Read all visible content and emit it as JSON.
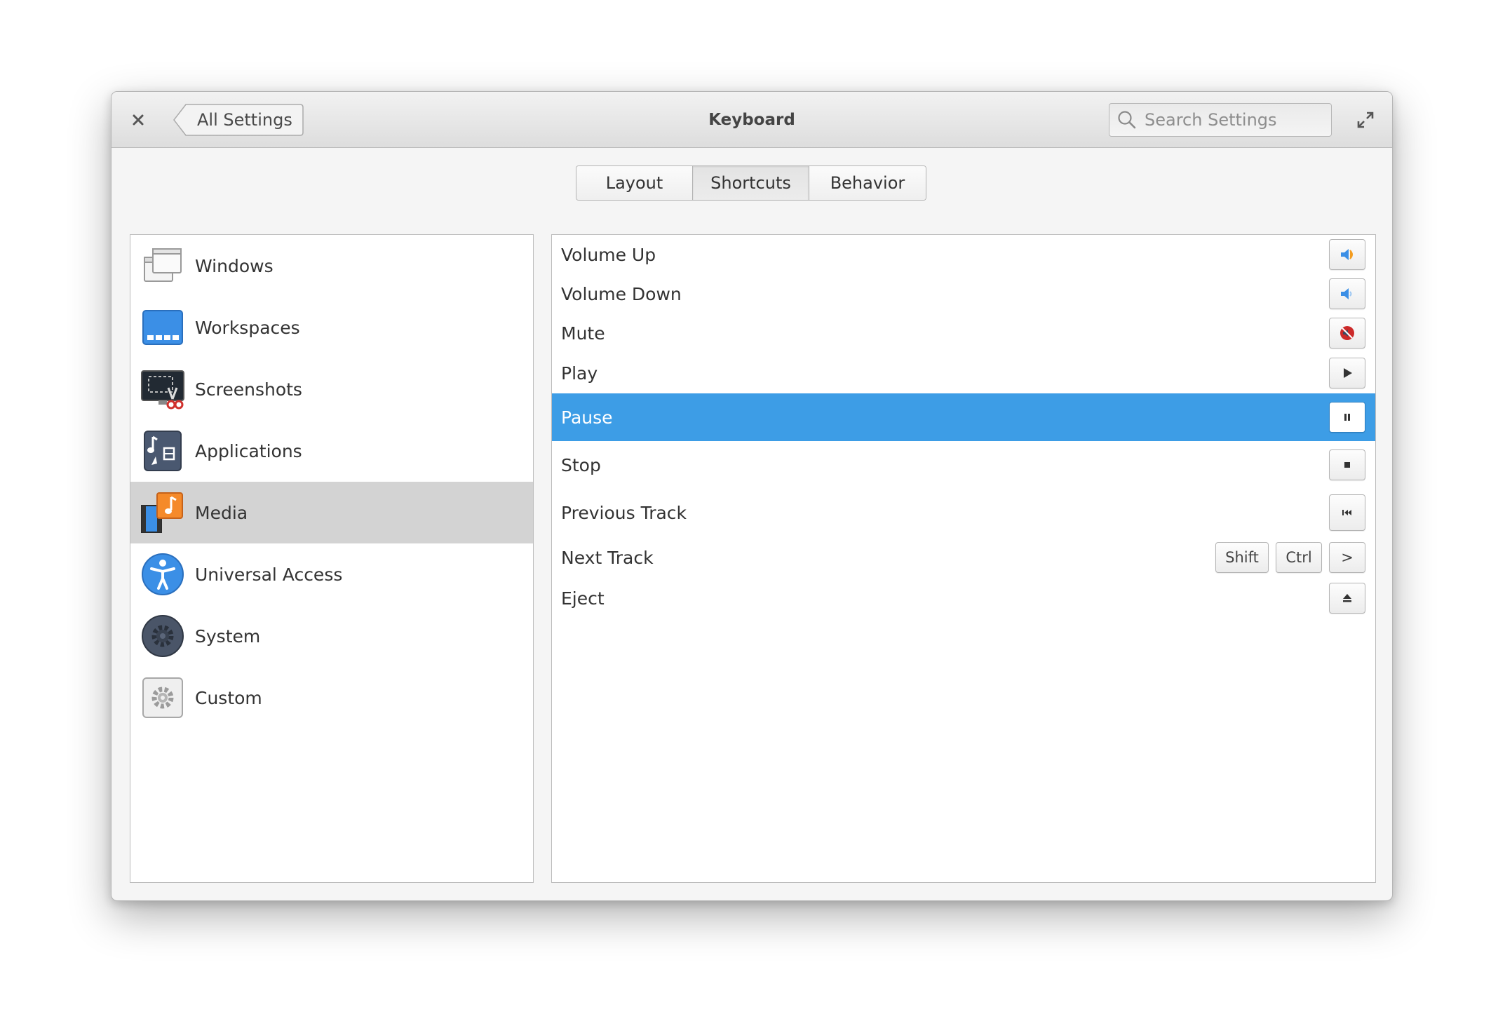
{
  "window": {
    "title": "Keyboard"
  },
  "header": {
    "close_icon": "close-icon",
    "back_label": "All Settings",
    "search_placeholder": "Search Settings",
    "maximize_icon": "maximize-icon"
  },
  "tabs": [
    {
      "label": "Layout",
      "active": false
    },
    {
      "label": "Shortcuts",
      "active": true
    },
    {
      "label": "Behavior",
      "active": false
    }
  ],
  "sidebar": {
    "items": [
      {
        "label": "Windows",
        "icon": "windows-icon",
        "selected": false
      },
      {
        "label": "Workspaces",
        "icon": "workspaces-icon",
        "selected": false
      },
      {
        "label": "Screenshots",
        "icon": "screenshots-icon",
        "selected": false
      },
      {
        "label": "Applications",
        "icon": "applications-icon",
        "selected": false
      },
      {
        "label": "Media",
        "icon": "media-icon",
        "selected": true
      },
      {
        "label": "Universal Access",
        "icon": "universal-access-icon",
        "selected": false
      },
      {
        "label": "System",
        "icon": "system-icon",
        "selected": false
      },
      {
        "label": "Custom",
        "icon": "custom-icon",
        "selected": false
      }
    ]
  },
  "shortcuts": [
    {
      "name": "Volume Up",
      "keys": [],
      "icon_key": "volume-up-icon"
    },
    {
      "name": "Volume Down",
      "keys": [],
      "icon_key": "volume-down-icon"
    },
    {
      "name": "Mute",
      "keys": [],
      "icon_key": "mute-icon"
    },
    {
      "name": "Play",
      "keys": [],
      "icon_key": "play-icon"
    },
    {
      "name": "Pause",
      "keys": [],
      "icon_key": "pause-icon",
      "selected": true
    },
    {
      "name": "Stop",
      "keys": [],
      "icon_key": "stop-icon"
    },
    {
      "name": "Previous Track",
      "keys": [],
      "icon_key": "previous-track-icon"
    },
    {
      "name": "Next Track",
      "keys": [
        "Shift",
        "Ctrl",
        ">"
      ],
      "icon_key": ""
    },
    {
      "name": "Eject",
      "keys": [],
      "icon_key": "eject-icon"
    }
  ],
  "colors": {
    "selection_blue": "#3d9de6",
    "sidebar_selected": "#d3d3d3",
    "mute_red": "#cc2a2a",
    "volume_orange": "#f39c1f"
  }
}
